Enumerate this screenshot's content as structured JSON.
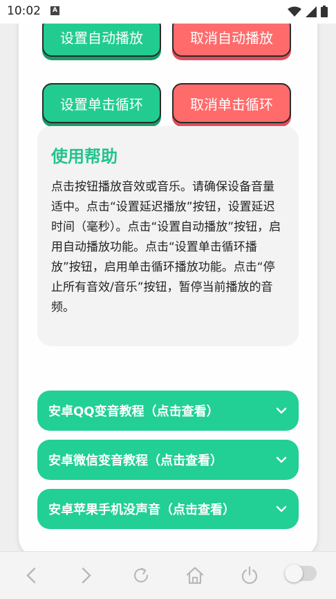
{
  "status_bar": {
    "time": "10:02",
    "notification_glyph": "A",
    "icons": [
      "wifi-icon",
      "signal-icon",
      "battery-icon"
    ]
  },
  "buttons": {
    "set_autoplay": "设置自动播放",
    "cancel_autoplay": "取消自动播放",
    "set_single_loop": "设置单击循环",
    "cancel_single_loop": "取消单击循环"
  },
  "help": {
    "title": "使用帮助",
    "body": "点击按钮播放音效或音乐。请确保设备音量适中。点击“设置延迟播放”按钮，设置延迟时间（毫秒）。点击“设置自动播放”按钮，启用自动播放功能。点击“设置单击循环播放”按钮，启用单击循环播放功能。点击“停止所有音效/音乐”按钮，暂停当前播放的音频。"
  },
  "accordions": [
    {
      "label": "安卓QQ变音教程（点击查看）"
    },
    {
      "label": "安卓微信变音教程（点击查看）"
    },
    {
      "label": "安卓苹果手机没声音（点击查看）"
    }
  ],
  "colors": {
    "green": "#22cc91",
    "red": "#ff6b6b",
    "help_title": "#22c38d"
  },
  "nav": {
    "icons": [
      "back-icon",
      "forward-icon",
      "refresh-icon",
      "home-icon",
      "power-icon",
      "toggle-switch"
    ]
  }
}
